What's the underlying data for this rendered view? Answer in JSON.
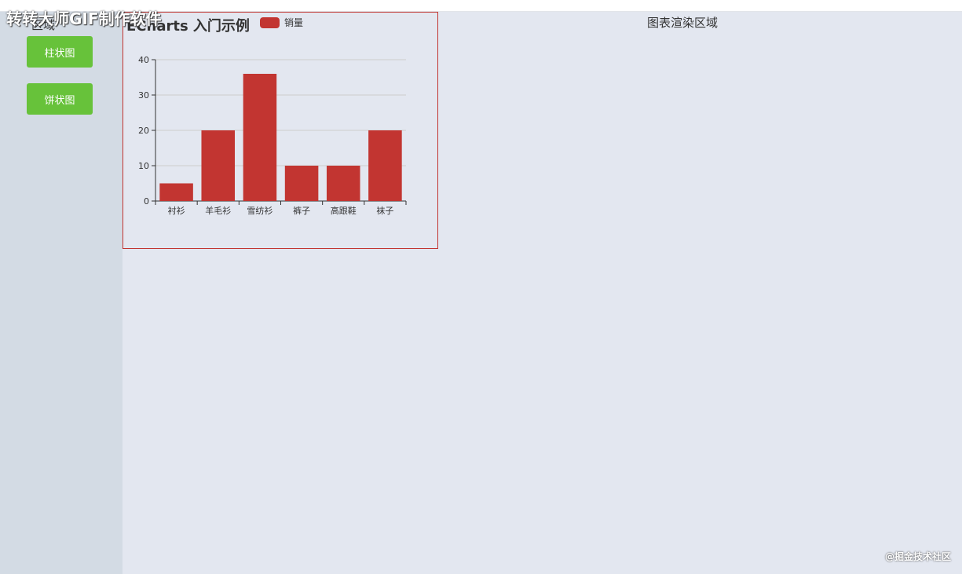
{
  "watermark": {
    "gif": "转转大师GIF制作软件",
    "bottom": "@掘金技术社区"
  },
  "sidebar": {
    "title": "区域",
    "buttons": [
      {
        "label": "柱状图"
      },
      {
        "label": "饼状图"
      }
    ]
  },
  "main": {
    "title": "图表渲染区域"
  },
  "chart": {
    "title": "ECharts 入门示例",
    "legend_label": "销量"
  },
  "colors": {
    "bar": "#c23531",
    "button": "#67c23a",
    "sidebar_bg": "#d3dbe4",
    "main_bg": "#e3e7f0"
  },
  "chart_data": {
    "type": "bar",
    "title": "ECharts 入门示例",
    "categories": [
      "衬衫",
      "羊毛衫",
      "雪纺衫",
      "裤子",
      "高跟鞋",
      "袜子"
    ],
    "series": [
      {
        "name": "销量",
        "values": [
          5,
          20,
          36,
          10,
          10,
          20
        ]
      }
    ],
    "yticks": [
      0,
      10,
      20,
      30,
      40
    ],
    "ylim": [
      0,
      40
    ],
    "grid": true,
    "legend_position": "top"
  }
}
